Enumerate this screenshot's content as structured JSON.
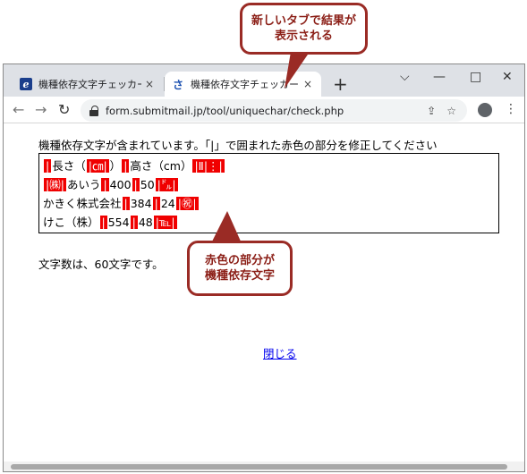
{
  "callouts": {
    "top": [
      "新しいタブで結果が",
      "表示される"
    ],
    "bottom": [
      "赤色の部分が",
      "機種依存文字"
    ]
  },
  "browser": {
    "tabs": [
      {
        "title": "機種依存文字チェッカー｜さぶみっと",
        "favicon": "e",
        "close": "×"
      },
      {
        "title": "機種依存文字チェッカー｜さぶみっと",
        "favicon": "さ",
        "close": "×"
      }
    ],
    "new_tab": "+",
    "url": "form.submitmail.jp/tool/uniquechar/check.php",
    "window_controls": [
      "⌵",
      "—",
      "□",
      "✕"
    ]
  },
  "page": {
    "intro": "機種依存文字が含まれています。「|」で囲まれた赤色の部分を修正してください",
    "lines": [
      [
        {
          "t": "|"
        },
        {
          "t": "長さ（"
        },
        {
          "t": "|㎝|",
          "red": true
        },
        {
          "t": "）"
        },
        {
          "t": "|"
        },
        {
          "t": "高さ（cm）"
        },
        {
          "t": "|Ⅱ|⋮|",
          "red": true
        }
      ],
      [
        {
          "t": "|㈱|",
          "red": true
        },
        {
          "t": "あいう"
        },
        {
          "t": "|"
        },
        {
          "t": "400"
        },
        {
          "t": "|"
        },
        {
          "t": "50"
        },
        {
          "t": "|㌦|",
          "red": true
        }
      ],
      [
        {
          "t": "かきく株式会社"
        },
        {
          "t": "|"
        },
        {
          "t": "384"
        },
        {
          "t": "|"
        },
        {
          "t": "24"
        },
        {
          "t": "|㊗|",
          "red": true
        }
      ],
      [
        {
          "t": "けこ（株）"
        },
        {
          "t": "|"
        },
        {
          "t": "554"
        },
        {
          "t": "|"
        },
        {
          "t": "48"
        },
        {
          "t": "|℡|",
          "red": true
        }
      ]
    ],
    "count_text": "文字数は、60文字です。",
    "close_link": "閉じる"
  }
}
